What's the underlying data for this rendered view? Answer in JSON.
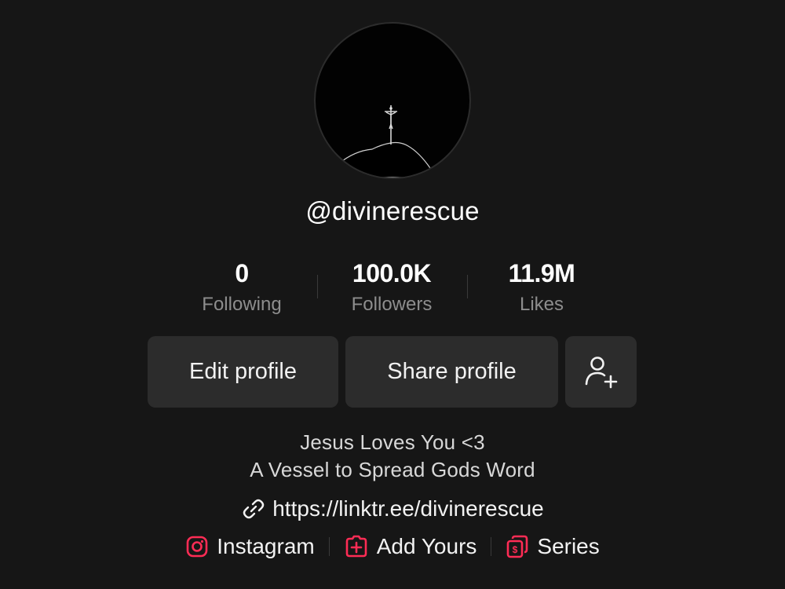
{
  "profile": {
    "username": "@divinerescue",
    "avatar_icon": "crucifix-on-hill-icon"
  },
  "stats": [
    {
      "value": "0",
      "label": "Following"
    },
    {
      "value": "100.0K",
      "label": "Followers"
    },
    {
      "value": "11.9M",
      "label": "Likes"
    }
  ],
  "actions": {
    "edit_label": "Edit profile",
    "share_label": "Share profile",
    "add_friend_icon": "add-user-icon"
  },
  "bio": {
    "line1": "Jesus Loves You <3",
    "line2": "A Vessel to Spread Gods Word"
  },
  "link": {
    "url": "https://linktr.ee/divinerescue",
    "icon": "link-icon"
  },
  "chips": [
    {
      "label": "Instagram",
      "icon": "instagram-icon"
    },
    {
      "label": "Add Yours",
      "icon": "add-yours-icon"
    },
    {
      "label": "Series",
      "icon": "series-icon"
    }
  ],
  "colors": {
    "background": "#161616",
    "button": "#2c2c2c",
    "muted_text": "#8d8d8d",
    "accent": "#fe2c55"
  }
}
